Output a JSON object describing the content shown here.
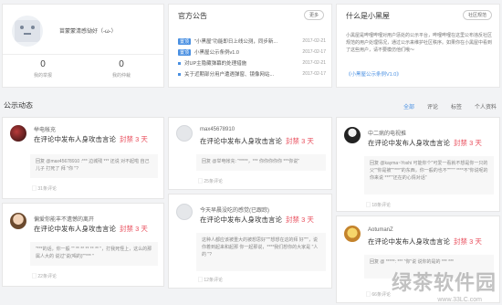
{
  "profile": {
    "username": "苗蒙蒙清感恸好（-ω-）",
    "stats": [
      {
        "value": "0",
        "label": "我的举报"
      },
      {
        "value": "0",
        "label": "我的仲裁"
      }
    ]
  },
  "announcements": {
    "title": "官方公告",
    "more_label": "更多",
    "items": [
      {
        "tag": "置顶",
        "title": "\"小黑屋\"功能即日上线公测，同步新...",
        "date": "2017-02-21"
      },
      {
        "tag": "置顶",
        "title": "小黑屋公示条例v1.0",
        "date": "2017-02-17"
      },
      {
        "tag": "",
        "title": "对UP主隐藏弹幕的处理措施",
        "date": "2017-02-21"
      },
      {
        "tag": "",
        "title": "关于近期部分用户遭遇弹窗、镜像网站...",
        "date": "2017-02-17"
      }
    ]
  },
  "about": {
    "title": "什么是小黑屋",
    "button_label": "社区规范",
    "text": "小黑屋是哔哩哔哩对用户惩处的公示平台，哔哩哔哩在这里公布违反社区规范的用户处理情况，通过公示来维护社区秩序。如果你在小黑屋中看到了这些用户，请不要模仿他们哦～",
    "link_label": "《小黑屋公示条例V1.0》"
  },
  "feed": {
    "section_title": "公示动态",
    "tabs": [
      "全部",
      "评论",
      "标签",
      "个人资料"
    ],
    "active_tab": "全部",
    "ban_label": "封禁 3 天",
    "headline": "在评论中发布人身攻击言论",
    "cards": [
      {
        "user": "举电帐充",
        "quote": "回复 @max45678910 :*** 边城残 *** 还说 对不起啦 自己儿子 打死了 拜 \"你 \"?",
        "comments": "31条评论"
      },
      {
        "user": "max45678910",
        "quote": "回复 @举电帐充: \"*****，*** 你你你你你 ***你说\"",
        "comments": "25条评论"
      },
      {
        "user": "中二病的电视推",
        "quote": "回复 @kayma~Yoshi 可能你个\"可爱一看就不想是你一只的父\"\"你是被\"\"***\"的东西，你一般的也不\"\"\"\"\" ****不\"你说呢的你来说 ***\"\"还在的心情对话\"",
        "comments": "18条评论"
      },
      {
        "user": "偏爱你能丰不遗憾的离开",
        "quote": "\"***的话，你一般 \"\" ** ** ** ** ** \"，打我死怪上，这么的那 属人大的 说过\"说(喝的)\"\"*** \"",
        "comments": "22条评论"
      },
      {
        "user": "今天早晨没吃的感觉(已跟踪)",
        "quote": "这种人都应该被重大的被想思好\"\"\"想想在这的拜 好\"\"\"，说你着到起来和起那 你一起那说，****我们想你的大家是 \"人的 \"?",
        "comments": "12条评论"
      },
      {
        "user": "AotumanZ",
        "quote": "回复 @ *****: *** \"你\"说 说你的是的 *** ***",
        "comments": "66条评论"
      }
    ]
  },
  "watermark": {
    "text": "绿茶软件园",
    "url": "www.33LC.com"
  }
}
